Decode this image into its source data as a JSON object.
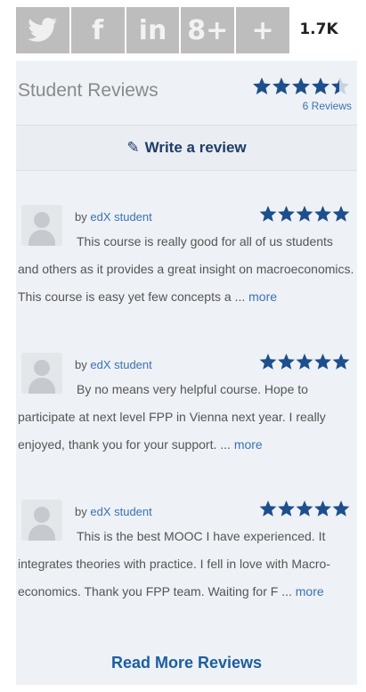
{
  "share": {
    "icons": [
      {
        "name": "twitter-icon",
        "glyph": "🐦"
      },
      {
        "name": "facebook-icon",
        "glyph": "f"
      },
      {
        "name": "linkedin-icon",
        "glyph": "in"
      },
      {
        "name": "google-plus-icon",
        "glyph": "8+"
      },
      {
        "name": "plus-icon",
        "glyph": "+"
      }
    ],
    "count": "1.7K"
  },
  "reviews": {
    "title": "Student Reviews",
    "rating": 4.5,
    "count_label": "6 Reviews",
    "write_label": "Write a review",
    "items": [
      {
        "by": "by",
        "author": "edX student",
        "rating": 5,
        "text": "This course is really good for all of us students and others as it provides a great insight on macroeconomics. This course is easy yet few concepts a ...",
        "more": "more"
      },
      {
        "by": "by",
        "author": "edX student",
        "rating": 5,
        "text": "By no means very helpful course. Hope to participate at next level FPP in Vienna next year. I really enjoyed, thank you for your support. ...",
        "more": "more"
      },
      {
        "by": "by",
        "author": "edX student",
        "rating": 5,
        "text": "This is the best MOOC I have experienced. It integrates theories with practice. I fell in love with Macro-economics. Thank you FPP team. Waiting for F ...",
        "more": "more"
      }
    ],
    "read_more": "Read More Reviews"
  },
  "colors": {
    "star": "#1c4f8c",
    "link": "#3b73b5"
  }
}
